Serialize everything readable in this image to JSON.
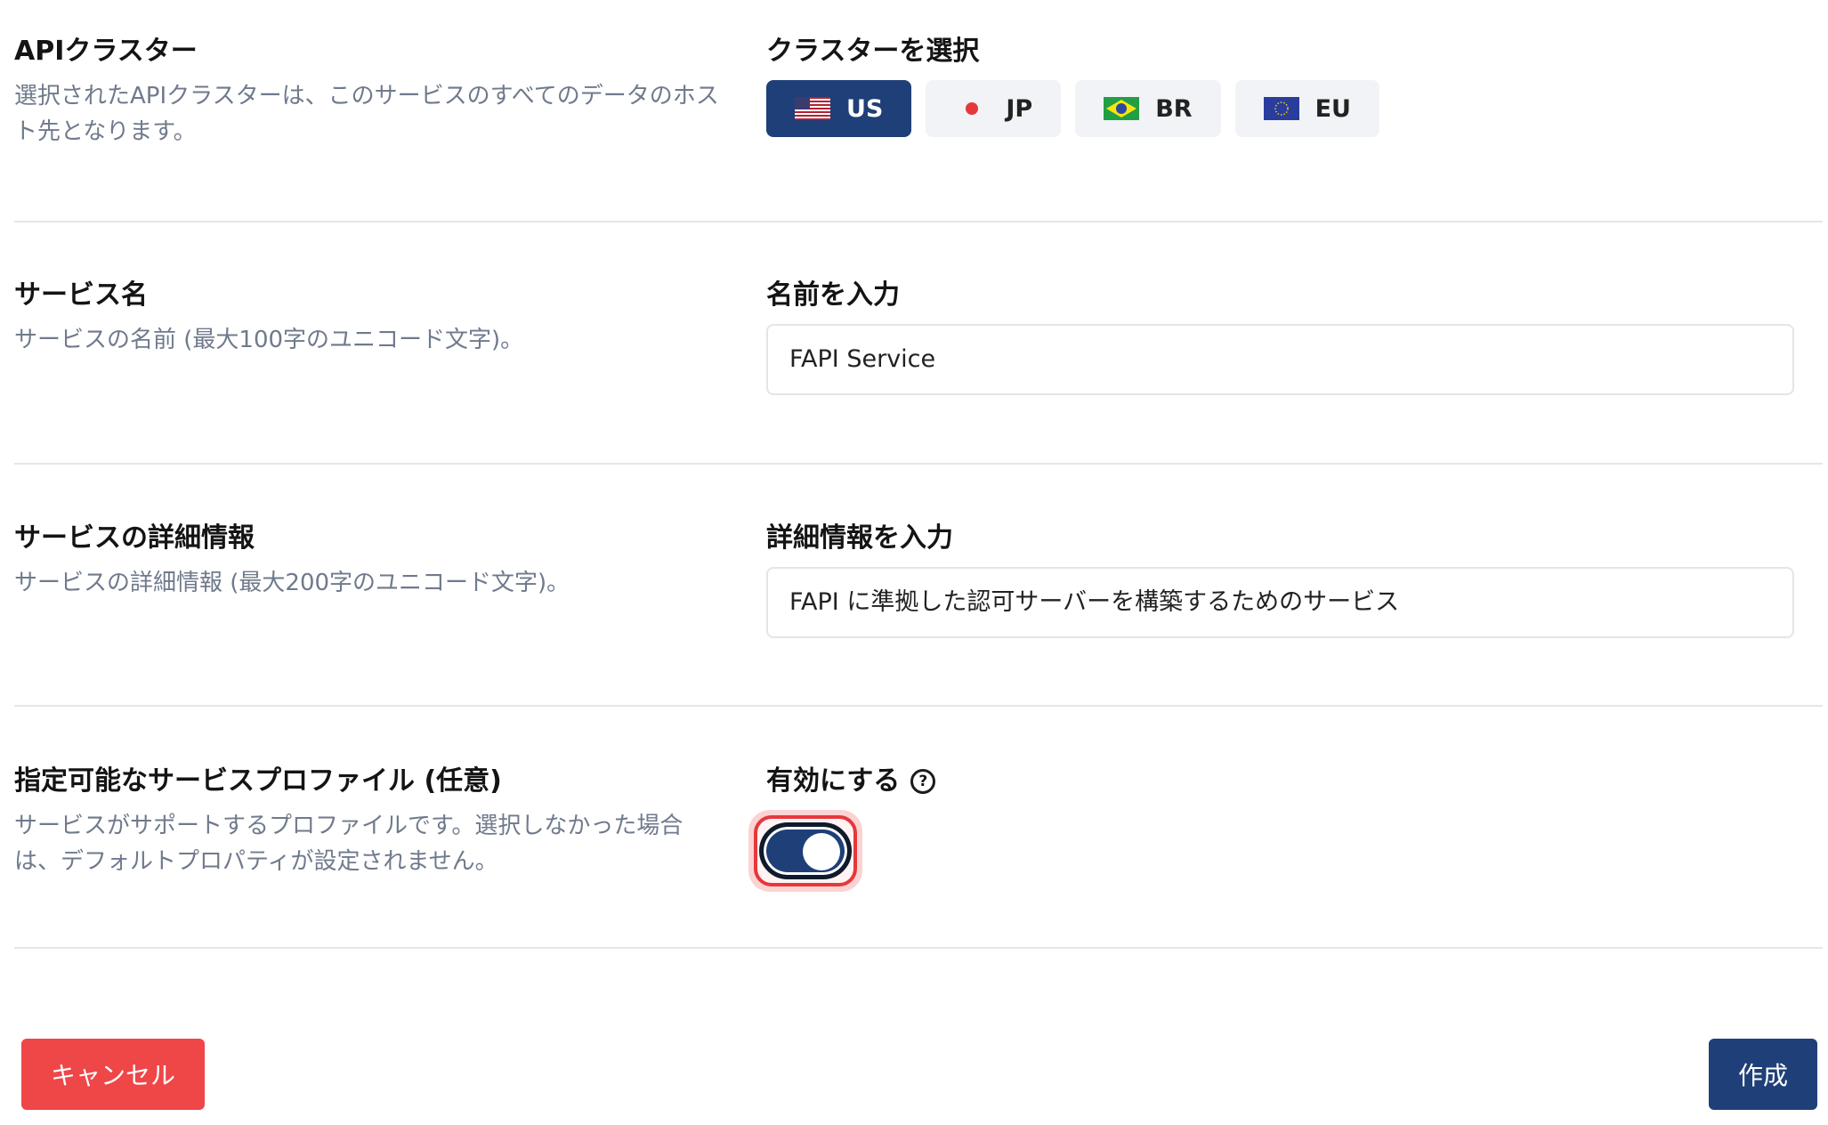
{
  "cluster_section": {
    "title": "APIクラスター",
    "description": "選択されたAPIクラスターは、このサービスのすべてのデータのホスト先となります。",
    "select_label": "クラスターを選択",
    "options": [
      {
        "code": "US",
        "flag": "us-flag-icon",
        "selected": true
      },
      {
        "code": "JP",
        "flag": "jp-flag-icon",
        "selected": false
      },
      {
        "code": "BR",
        "flag": "br-flag-icon",
        "selected": false
      },
      {
        "code": "EU",
        "flag": "eu-flag-icon",
        "selected": false
      }
    ]
  },
  "name_section": {
    "title": "サービス名",
    "description": "サービスの名前 (最大100字のユニコード文字)。",
    "input_label": "名前を入力",
    "input_value": "FAPI Service"
  },
  "details_section": {
    "title": "サービスの詳細情報",
    "description": "サービスの詳細情報 (最大200字のユニコード文字)。",
    "input_label": "詳細情報を入力",
    "input_value": "FAPI に準拠した認可サーバーを構築するためのサービス"
  },
  "profile_section": {
    "title": "指定可能なサービスプロファイル (任意)",
    "description": "サービスがサポートするプロファイルです。選択しなかった場合は、デフォルトプロパティが設定されません。",
    "toggle_label": "有効にする",
    "help_icon": "?",
    "toggle_on": true
  },
  "footer": {
    "cancel_label": "キャンセル",
    "create_label": "作成"
  },
  "colors": {
    "primary": "#1f3f78",
    "danger": "#ef4648",
    "muted_text": "#6f7a8c"
  }
}
